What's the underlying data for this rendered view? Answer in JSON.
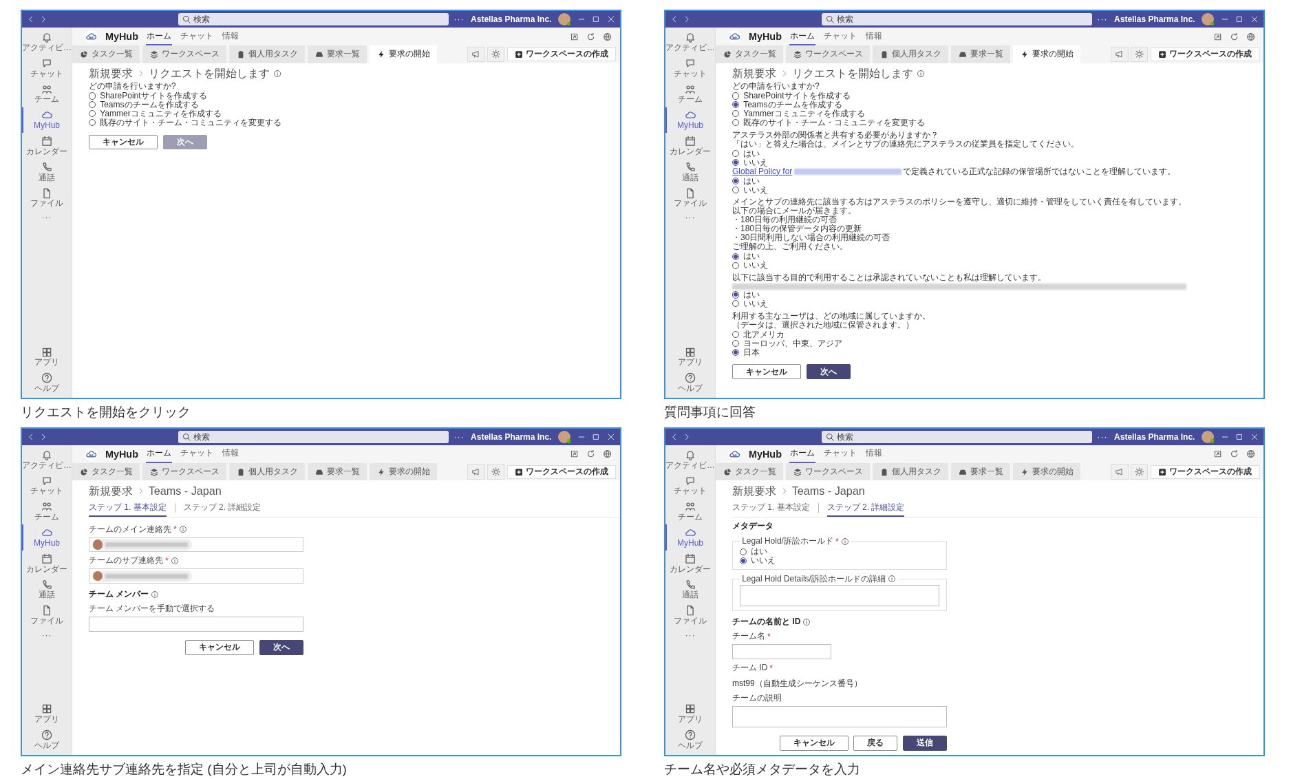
{
  "panels": [
    {
      "titlebar": {
        "search_placeholder": "検索",
        "more": "···",
        "account": "Astellas Pharma Inc."
      },
      "rail": [
        {
          "label": "アクティビ…",
          "selected": false
        },
        {
          "label": "チャット",
          "selected": false
        },
        {
          "label": "チーム",
          "selected": false
        },
        {
          "label": "MyHub",
          "selected": true
        },
        {
          "label": "カレンダー",
          "selected": false
        },
        {
          "label": "通話",
          "selected": false
        },
        {
          "label": "ファイル",
          "selected": false
        }
      ],
      "rail_more": "···",
      "rail_bottom": [
        {
          "label": "アプリ"
        },
        {
          "label": "ヘルプ"
        }
      ],
      "app": {
        "name": "MyHub",
        "nav": [
          {
            "label": "ホーム",
            "selected": true
          },
          {
            "label": "チャット",
            "selected": false
          },
          {
            "label": "情報",
            "selected": false
          }
        ]
      },
      "tabs": [
        {
          "label": "タスク一覧",
          "selected": false
        },
        {
          "label": "ワークスペース",
          "selected": false
        },
        {
          "label": "個人用タスク",
          "selected": false
        },
        {
          "label": "要求一覧",
          "selected": false
        },
        {
          "label": "要求の開始",
          "selected": true
        }
      ],
      "create_button": "ワークスペースの作成",
      "breadcrumb": [
        "新規要求",
        "リクエストを開始します"
      ],
      "title_info": true,
      "body": [
        {
          "kind": "text",
          "lines": [
            "どの申請を行いますか?"
          ]
        },
        {
          "kind": "radio",
          "options": [
            {
              "label": "SharePointサイトを作成する",
              "selected": false
            },
            {
              "label": "Teamsのチームを作成する",
              "selected": false
            },
            {
              "label": "Yammerコミュニティを作成する",
              "selected": false
            },
            {
              "label": "既存のサイト・チーム・コミュニティを変更する",
              "selected": false
            }
          ]
        }
      ],
      "buttons": [
        {
          "label": "キャンセル",
          "kind": "secondary"
        },
        {
          "label": "次へ",
          "kind": "disabled"
        }
      ],
      "caption": "リクエストを開始をクリック"
    },
    {
      "titlebar": {
        "search_placeholder": "検索",
        "more": "···",
        "account": "Astellas Pharma Inc."
      },
      "rail": [
        {
          "label": "アクティビ…",
          "selected": false
        },
        {
          "label": "チャット",
          "selected": false
        },
        {
          "label": "チーム",
          "selected": false
        },
        {
          "label": "MyHub",
          "selected": true
        },
        {
          "label": "カレンダー",
          "selected": false
        },
        {
          "label": "通話",
          "selected": false
        },
        {
          "label": "ファイル",
          "selected": false
        }
      ],
      "rail_more": "···",
      "rail_bottom": [
        {
          "label": "アプリ"
        },
        {
          "label": "ヘルプ"
        }
      ],
      "app": {
        "name": "MyHub",
        "nav": [
          {
            "label": "ホーム",
            "selected": true
          },
          {
            "label": "チャット",
            "selected": false
          },
          {
            "label": "情報",
            "selected": false
          }
        ]
      },
      "tabs": [
        {
          "label": "タスク一覧",
          "selected": false
        },
        {
          "label": "ワークスペース",
          "selected": false
        },
        {
          "label": "個人用タスク",
          "selected": false
        },
        {
          "label": "要求一覧",
          "selected": false
        },
        {
          "label": "要求の開始",
          "selected": true
        }
      ],
      "create_button": "ワークスペースの作成",
      "breadcrumb": [
        "新規要求",
        "リクエストを開始します"
      ],
      "title_info": true,
      "body": [
        {
          "kind": "text",
          "lines": [
            "どの申請を行いますか?"
          ]
        },
        {
          "kind": "radio",
          "options": [
            {
              "label": "SharePointサイトを作成する",
              "selected": false
            },
            {
              "label": "Teamsのチームを作成する",
              "selected": true
            },
            {
              "label": "Yammerコミュニティを作成する",
              "selected": false
            },
            {
              "label": "既存のサイト・チーム・コミュニティを変更する",
              "selected": false
            }
          ]
        },
        {
          "kind": "text",
          "lines": [
            "アステラス外部の関係者と共有する必要がありますか？",
            "「はい」と答えた場合は、メインとサブの連絡先にアステラスの従業員を指定してください。"
          ]
        },
        {
          "kind": "radio",
          "options": [
            {
              "label": "はい",
              "selected": false
            },
            {
              "label": "いいえ",
              "selected": true
            }
          ]
        },
        {
          "kind": "link_text",
          "link": "Global Policy for",
          "redacted": true,
          "text": "で定義されている正式な記録の保管場所ではないことを理解しています。"
        },
        {
          "kind": "radio",
          "options": [
            {
              "label": "はい",
              "selected": true
            },
            {
              "label": "いいえ",
              "selected": false
            }
          ]
        },
        {
          "kind": "text",
          "lines": [
            "メインとサブの連絡先に該当する方はアステラスのポリシーを遵守し、適切に維持・管理をしていく責任を有しています。",
            "以下の場合にメールが届きます。",
            "・180日毎の利用継続の可否",
            "・180日毎の保管データ内容の更新",
            "・30日間利用しない場合の利用継続の可否",
            "ご理解の上、ご利用ください。"
          ]
        },
        {
          "kind": "radio",
          "options": [
            {
              "label": "はい",
              "selected": true
            },
            {
              "label": "いいえ",
              "selected": false
            }
          ]
        },
        {
          "kind": "text",
          "lines": [
            "以下に該当する目的で利用することは承認されていないことも私は理解しています。"
          ],
          "redacted": true
        },
        {
          "kind": "radio",
          "options": [
            {
              "label": "はい",
              "selected": true
            },
            {
              "label": "いいえ",
              "selected": false
            }
          ]
        },
        {
          "kind": "text",
          "lines": [
            "利用する主なユーザは、どの地域に属していますか。",
            "（データは、選択された地域に保管されます。）"
          ]
        },
        {
          "kind": "radio",
          "options": [
            {
              "label": "北アメリカ",
              "selected": false
            },
            {
              "label": "ヨーロッパ、中東、アジア",
              "selected": false
            },
            {
              "label": "日本",
              "selected": true
            }
          ]
        }
      ],
      "buttons": [
        {
          "label": "キャンセル",
          "kind": "secondary"
        },
        {
          "label": "次へ",
          "kind": "primary"
        }
      ],
      "caption": "質問事項に回答"
    },
    {
      "titlebar": {
        "search_placeholder": "検索",
        "more": "···",
        "account": "Astellas Pharma Inc."
      },
      "rail": [
        {
          "label": "アクティビ…",
          "selected": false
        },
        {
          "label": "チャット",
          "selected": false
        },
        {
          "label": "チーム",
          "selected": false
        },
        {
          "label": "MyHub",
          "selected": true
        },
        {
          "label": "カレンダー",
          "selected": false
        },
        {
          "label": "通話",
          "selected": false
        },
        {
          "label": "ファイル",
          "selected": false
        }
      ],
      "rail_more": "···",
      "rail_bottom": [
        {
          "label": "アプリ"
        },
        {
          "label": "ヘルプ"
        }
      ],
      "app": {
        "name": "MyHub",
        "nav": [
          {
            "label": "ホーム",
            "selected": true
          },
          {
            "label": "チャット",
            "selected": false
          },
          {
            "label": "情報",
            "selected": false
          }
        ]
      },
      "tabs": [
        {
          "label": "タスク一覧",
          "selected": false
        },
        {
          "label": "ワークスペース",
          "selected": false
        },
        {
          "label": "個人用タスク",
          "selected": false
        },
        {
          "label": "要求一覧",
          "selected": false
        },
        {
          "label": "要求の開始",
          "selected": false
        }
      ],
      "create_button": "ワークスペースの作成",
      "breadcrumb": [
        "新規要求",
        "Teams - Japan"
      ],
      "steps": [
        {
          "label": "ステップ 1. 基本設定",
          "selected": true
        },
        {
          "label": "ステップ 2. 詳細設定",
          "selected": false
        }
      ],
      "body": [
        {
          "kind": "people",
          "label": "チームのメイン連絡先",
          "mark": "*",
          "info": true
        },
        {
          "kind": "people",
          "label": "チームのサブ連絡先",
          "mark": "*",
          "info": true
        },
        {
          "kind": "heading",
          "text": "チーム メンバー",
          "info": true
        },
        {
          "kind": "input",
          "label": "チーム メンバーを手動で選択する"
        }
      ],
      "buttons": [
        {
          "label": "キャンセル",
          "kind": "secondary"
        },
        {
          "label": "次へ",
          "kind": "primary"
        }
      ],
      "caption": "メイン連絡先サブ連絡先を指定 (自分と上司が自動入力)"
    },
    {
      "titlebar": {
        "search_placeholder": "検索",
        "more": "···",
        "account": "Astellas Pharma Inc."
      },
      "rail": [
        {
          "label": "アクティビ…",
          "selected": false
        },
        {
          "label": "チャット",
          "selected": false
        },
        {
          "label": "チーム",
          "selected": false
        },
        {
          "label": "MyHub",
          "selected": true
        },
        {
          "label": "カレンダー",
          "selected": false
        },
        {
          "label": "通話",
          "selected": false
        },
        {
          "label": "ファイル",
          "selected": false
        }
      ],
      "rail_more": "···",
      "rail_bottom": [
        {
          "label": "アプリ"
        },
        {
          "label": "ヘルプ"
        }
      ],
      "app": {
        "name": "MyHub",
        "nav": [
          {
            "label": "ホーム",
            "selected": true
          },
          {
            "label": "チャット",
            "selected": false
          },
          {
            "label": "情報",
            "selected": false
          }
        ]
      },
      "tabs": [
        {
          "label": "タスク一覧",
          "selected": false
        },
        {
          "label": "ワークスペース",
          "selected": false
        },
        {
          "label": "個人用タスク",
          "selected": false
        },
        {
          "label": "要求一覧",
          "selected": false
        },
        {
          "label": "要求の開始",
          "selected": false
        }
      ],
      "create_button": "ワークスペースの作成",
      "breadcrumb": [
        "新規要求",
        "Teams - Japan"
      ],
      "steps": [
        {
          "label": "ステップ 1. 基本設定",
          "selected": false
        },
        {
          "label": "ステップ 2. 詳細設定",
          "selected": true
        }
      ],
      "body": [
        {
          "kind": "heading",
          "text": "メタデータ"
        },
        {
          "kind": "fieldset_radio",
          "legend": "Legal Hold/訴訟ホールド",
          "mark": "*",
          "info": true,
          "options": [
            {
              "label": "はい",
              "selected": false
            },
            {
              "label": "いいえ",
              "selected": true
            }
          ]
        },
        {
          "kind": "fieldset_text",
          "legend": "Legal Hold Details/訴訟ホールドの詳細",
          "info": true
        },
        {
          "kind": "heading",
          "text": "チームの名前と ID",
          "info": true
        },
        {
          "kind": "short_input",
          "label": "チーム名",
          "mark": "*"
        },
        {
          "kind": "static",
          "label": "チーム ID",
          "mark": "*",
          "value": "mst99（自動生成シーケンス番号）"
        },
        {
          "kind": "textarea",
          "label": "チームの説明"
        }
      ],
      "buttons": [
        {
          "label": "キャンセル",
          "kind": "secondary"
        },
        {
          "label": "戻る",
          "kind": "secondary"
        },
        {
          "label": "送信",
          "kind": "primary"
        }
      ],
      "caption": "チーム名や必須メタデータを入力"
    }
  ]
}
